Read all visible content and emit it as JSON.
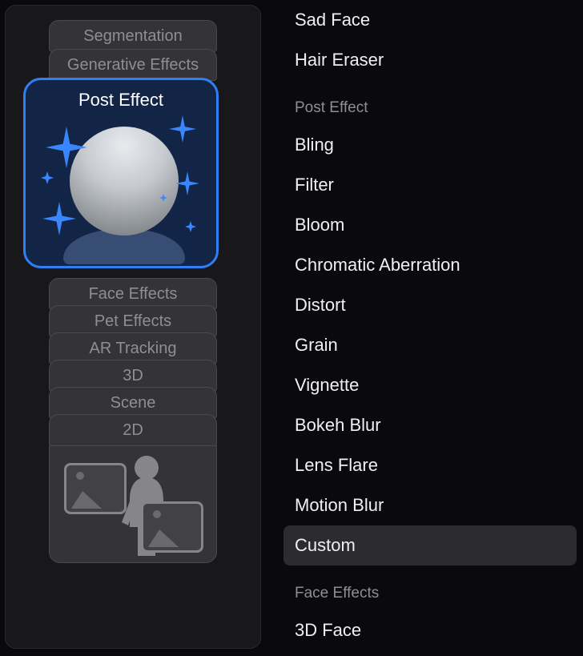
{
  "panel": {
    "cards_above": [
      "Segmentation",
      "Generative Effects"
    ],
    "selected": {
      "title": "Post Effect"
    },
    "cards_below": [
      "Face Effects",
      "Pet Effects",
      "AR Tracking",
      "3D",
      "Scene",
      "2D"
    ]
  },
  "right": {
    "top_items": [
      "Sad Face",
      "Hair Eraser"
    ],
    "section1": {
      "title": "Post Effect",
      "items": [
        "Bling",
        "Filter",
        "Bloom",
        "Chromatic Aberration",
        "Distort",
        "Grain",
        "Vignette",
        "Bokeh Blur",
        "Lens Flare",
        "Motion Blur",
        "Custom"
      ],
      "hovered_index": 10
    },
    "section2": {
      "title": "Face Effects",
      "items": [
        "3D Face"
      ]
    }
  }
}
